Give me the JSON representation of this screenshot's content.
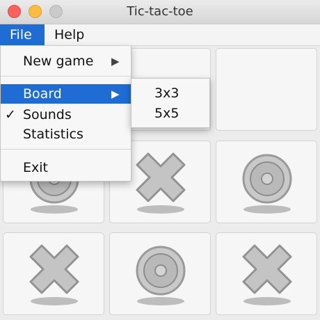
{
  "window": {
    "title": "Tic-tac-toe"
  },
  "menubar": {
    "items": [
      {
        "label": "File"
      },
      {
        "label": "Help"
      }
    ]
  },
  "file_menu": {
    "items": [
      {
        "label": "New game",
        "has_submenu": true
      },
      {
        "label": "Board",
        "has_submenu": true,
        "highlighted": true
      },
      {
        "label": "Sounds",
        "checked": true,
        "check_mark": "✓"
      },
      {
        "label": "Statistics"
      },
      {
        "label": "Exit"
      }
    ],
    "submenu_arrow": "▶"
  },
  "board_submenu": {
    "items": [
      {
        "label": "3x3"
      },
      {
        "label": "5x5"
      }
    ]
  },
  "board": {
    "cells": [
      "empty",
      "empty",
      "empty",
      "o",
      "x",
      "o",
      "x",
      "o",
      "x"
    ],
    "state": "disabled"
  },
  "colors": {
    "menu_highlight": "#1f6dd4",
    "close": "#fc605c",
    "minimize": "#fdbc40",
    "zoom_inactive": "#cacaca"
  }
}
